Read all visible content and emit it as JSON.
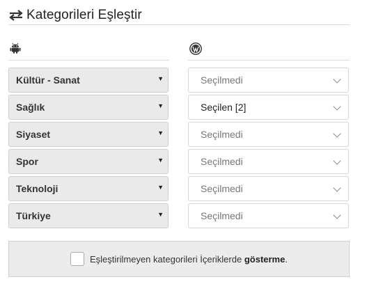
{
  "header": {
    "title": "Kategorileri Eşleştir",
    "icon": "swap-arrows-icon"
  },
  "columns": {
    "left_icon": "android-icon",
    "right_icon": "wordpress-icon"
  },
  "rows": [
    {
      "category": "Kültür - Sanat",
      "mapping": "Seçilmedi"
    },
    {
      "category": "Sağlık",
      "mapping": "Seçilen [2]"
    },
    {
      "category": "Siyaset",
      "mapping": "Seçilmedi"
    },
    {
      "category": "Spor",
      "mapping": "Seçilmedi"
    },
    {
      "category": "Teknoloji",
      "mapping": "Seçilmedi"
    },
    {
      "category": "Türkiye",
      "mapping": "Seçilmedi"
    }
  ],
  "footer": {
    "text_before": "Eşleştirilmeyen kategorileri İçeriklerde",
    "text_bold": "gösterme",
    "text_after": ".",
    "checked": false
  }
}
